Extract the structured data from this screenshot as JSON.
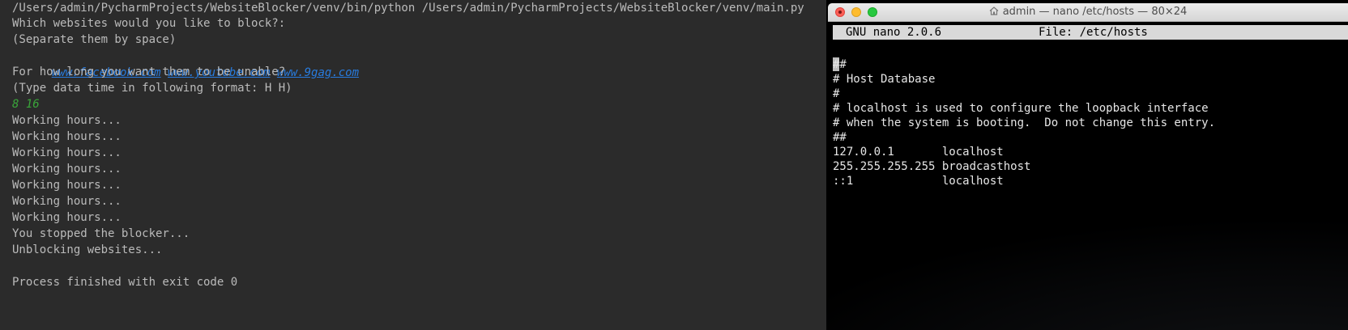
{
  "console": {
    "command": "/Users/admin/PycharmProjects/WebsiteBlocker/venv/bin/python /Users/admin/PycharmProjects/WebsiteBlocker/venv/main.py",
    "prompt_sites": "Which websites would you like to block?:",
    "hint_sites": "(Separate them by space)",
    "links": [
      "www.facebook.com",
      "www.youtube.com",
      "www.9gag.com"
    ],
    "prompt_time": "For how long you want them to be unable?",
    "hint_time": "(Type data time in following format: H H)",
    "time_input": "8 16",
    "working_lines": [
      "Working hours...",
      "Working hours...",
      "Working hours...",
      "Working hours...",
      "Working hours...",
      "Working hours...",
      "Working hours..."
    ],
    "stopped": "You stopped the blocker...",
    "unblocking": "Unblocking websites...",
    "exit": "Process finished with exit code 0"
  },
  "terminal": {
    "title": "admin — nano /etc/hosts — 80×24",
    "nano_version": "GNU nano 2.0.6",
    "nano_file": "File: /etc/hosts",
    "cursor_char": "#",
    "lines": [
      "##",
      "# Host Database",
      "#",
      "# localhost is used to configure the loopback interface",
      "# when the system is booting.  Do not change this entry.",
      "##",
      "127.0.0.1       localhost",
      "255.255.255.255 broadcasthost",
      "::1             localhost"
    ]
  },
  "colors": {
    "console_bg": "#2b2b2b",
    "console_text": "#bbbbbb",
    "link": "#287bde",
    "input_echo": "#3aa53a",
    "nano_header_bg": "#d9d9d9"
  }
}
